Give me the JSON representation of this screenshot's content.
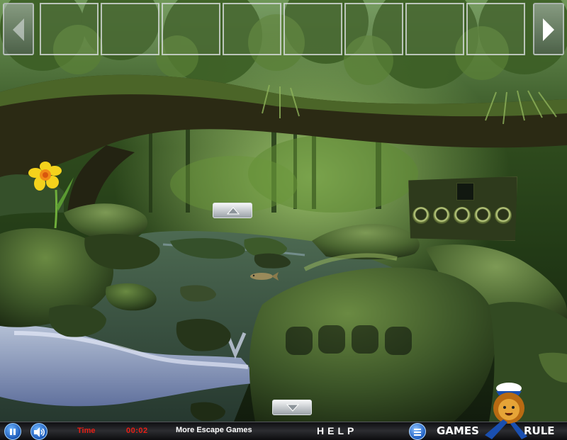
{
  "scene": {
    "background_colors": {
      "sky": "#8fb873",
      "canopy": "#1c3312",
      "log": "#2b2a14",
      "moss": "#48632a",
      "water": "#3a5246",
      "rock": "#3f5a2e"
    }
  },
  "inventory": {
    "slot_count": 8,
    "left_arrow_icon": "chevron-left-icon",
    "right_arrow_icon": "chevron-right-icon"
  },
  "puzzle": {
    "button_count": 5
  },
  "bottom_bar": {
    "time_label": "Time",
    "time_value": "00:02",
    "more_games": "More Escape Games",
    "help": "HELP",
    "pause_icon": "pause-icon",
    "sound_icon": "speaker-icon",
    "menu_icon": "menu-icon"
  },
  "logo": {
    "word1": "GAMES",
    "word2": "RULE"
  },
  "colors": {
    "time_text": "#e81f16",
    "button_blue": "#1c59b7"
  }
}
